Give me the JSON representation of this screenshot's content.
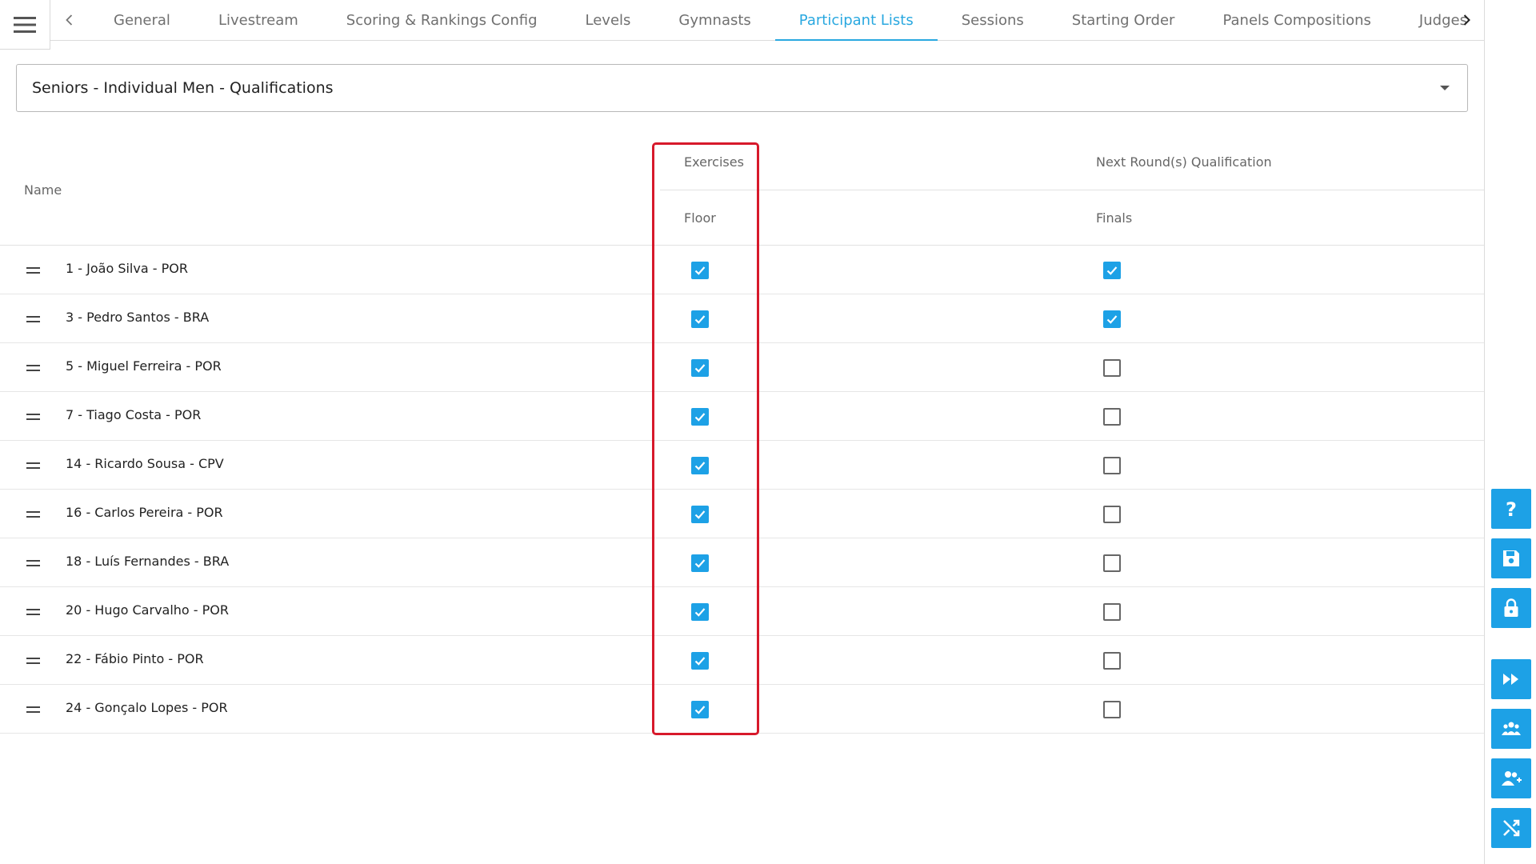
{
  "tabs": [
    {
      "label": "General"
    },
    {
      "label": "Livestream"
    },
    {
      "label": "Scoring & Rankings Config"
    },
    {
      "label": "Levels"
    },
    {
      "label": "Gymnasts"
    },
    {
      "label": "Participant Lists"
    },
    {
      "label": "Sessions"
    },
    {
      "label": "Starting Order"
    },
    {
      "label": "Panels Compositions"
    },
    {
      "label": "Judges"
    }
  ],
  "active_tab": "Participant Lists",
  "list_select": {
    "value": "Seniors - Individual Men - Qualifications"
  },
  "table": {
    "name_header": "Name",
    "exercises_header": "Exercises",
    "exercise_col": "Floor",
    "qualification_header": "Next Round(s) Qualification",
    "qualification_col": "Finals",
    "rows": [
      {
        "label": "1 - João Silva - POR",
        "floor": true,
        "finals": true
      },
      {
        "label": "3 - Pedro Santos - BRA",
        "floor": true,
        "finals": true
      },
      {
        "label": "5 - Miguel Ferreira - POR",
        "floor": true,
        "finals": false
      },
      {
        "label": "7 - Tiago Costa - POR",
        "floor": true,
        "finals": false
      },
      {
        "label": "14 - Ricardo Sousa - CPV",
        "floor": true,
        "finals": false
      },
      {
        "label": "16 - Carlos Pereira - POR",
        "floor": true,
        "finals": false
      },
      {
        "label": "18 - Luís Fernandes - BRA",
        "floor": true,
        "finals": false
      },
      {
        "label": "20 - Hugo Carvalho - POR",
        "floor": true,
        "finals": false
      },
      {
        "label": "22 - Fábio Pinto - POR",
        "floor": true,
        "finals": false
      },
      {
        "label": "24 - Gonçalo Lopes - POR",
        "floor": true,
        "finals": false
      }
    ]
  },
  "rail_buttons": [
    {
      "icon": "help-icon"
    },
    {
      "icon": "save-icon"
    },
    {
      "icon": "lock-icon"
    },
    {
      "icon": "fast-forward-icon"
    },
    {
      "icon": "group-icon"
    },
    {
      "icon": "add-user-icon"
    },
    {
      "icon": "shuffle-icon"
    }
  ],
  "colors": {
    "accent": "#1da1e6",
    "highlight": "#d7192b",
    "tab_active": "#29a8e0"
  }
}
